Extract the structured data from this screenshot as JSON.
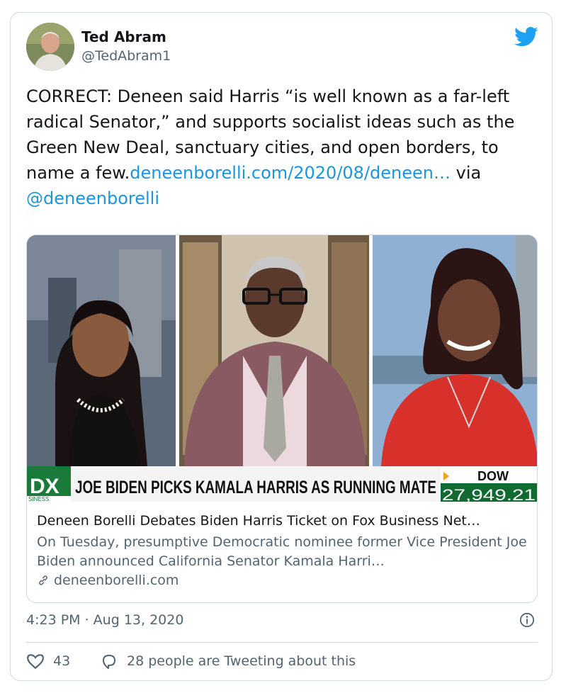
{
  "user": {
    "name": "Ted Abram",
    "handle": "@TedAbram1"
  },
  "tweet": {
    "text_prefix": "CORRECT: Deneen said Harris “is well known as a far-left radical Senator,” and supports socialist ideas such as the Green New Deal, sanctuary cities, and open borders, to name a few.",
    "link_text": "deneenborelli.com/2020/08/deneen…",
    "via": " via ",
    "mention": "@deneenborelli",
    "timestamp": "4:23 PM · Aug 13, 2020"
  },
  "media": {
    "ticker_left": "DX",
    "ticker_sub": "SINESS",
    "headline": "JOE BIDEN PICKS KAMALA HARRIS AS RUNNING MATE",
    "dow_label": "DOW",
    "dow_value": "27,949.21"
  },
  "link_card": {
    "title": "Deneen Borelli Debates Biden Harris Ticket on Fox Business Net…",
    "description": "On Tuesday, presumptive Democratic nominee former Vice President Joe Biden announced California Senator Kamala Harri…",
    "domain": "deneenborelli.com"
  },
  "engagement": {
    "likes": "43",
    "talking": "28 people are Tweeting about this"
  },
  "colors": {
    "link": "#1b95e0",
    "twitter_blue": "#1da1f2",
    "muted": "#536471"
  },
  "icons": [
    "twitter-bird-icon",
    "link-icon",
    "info-icon",
    "heart-icon",
    "reply-bubble-icon"
  ]
}
